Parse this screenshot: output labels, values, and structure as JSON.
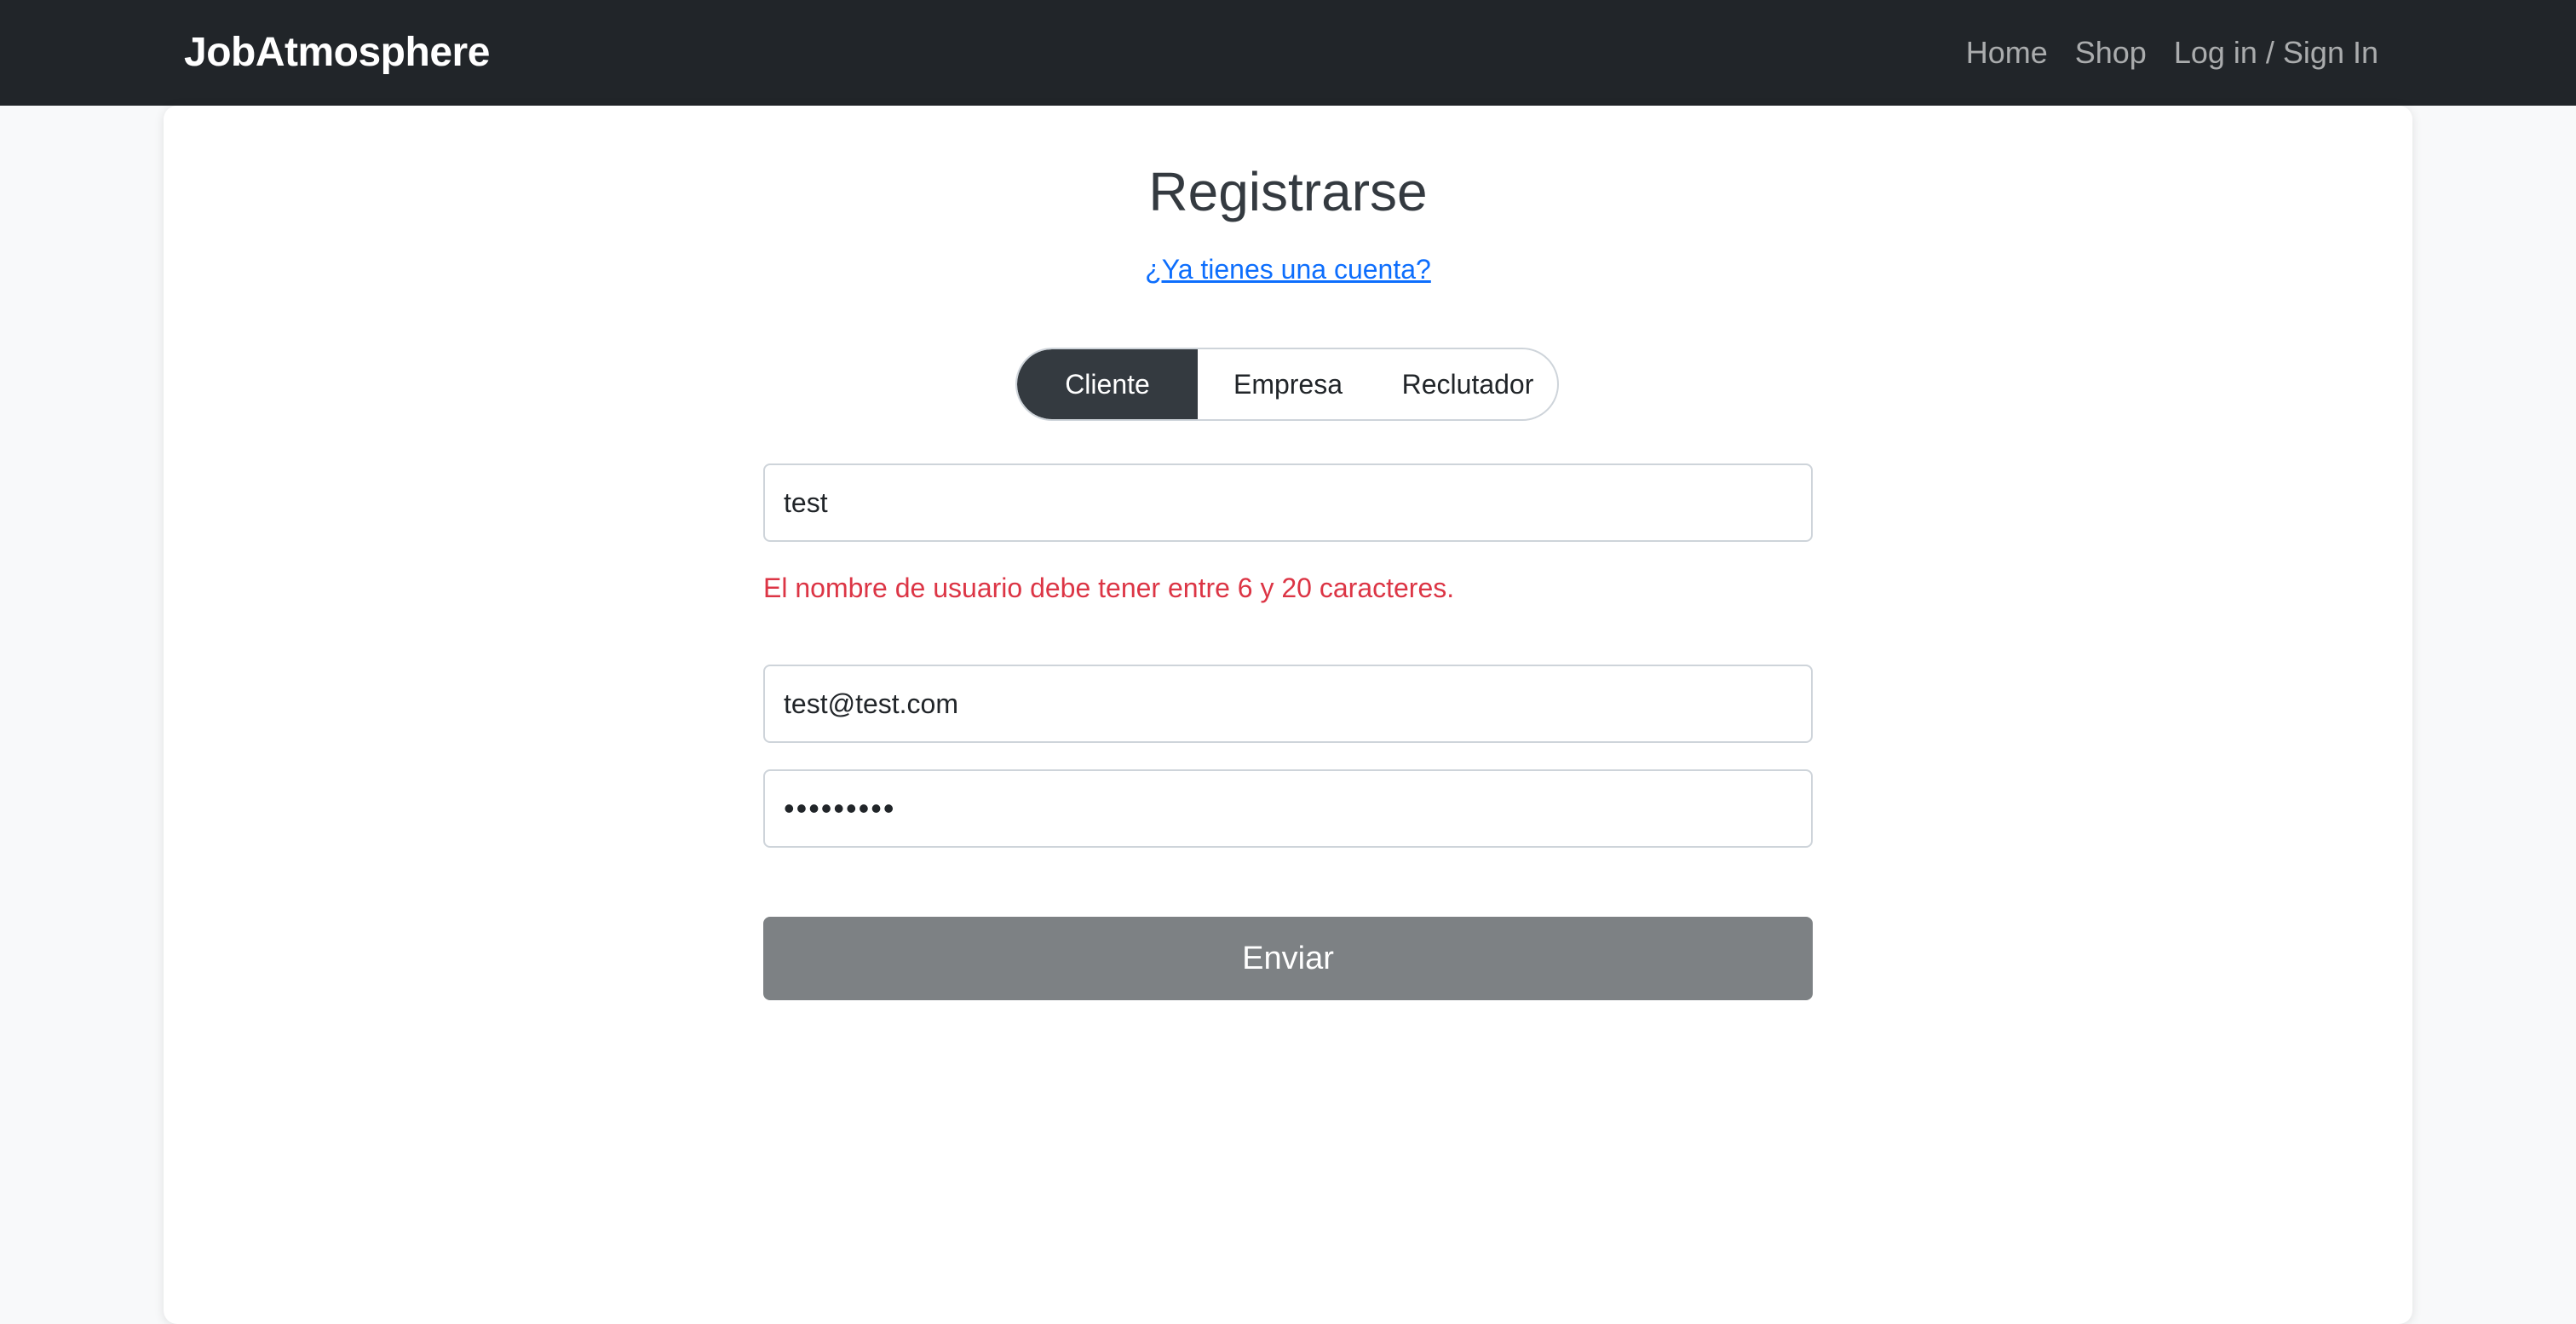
{
  "navbar": {
    "brand": "JobAtmosphere",
    "links": [
      {
        "label": "Home"
      },
      {
        "label": "Shop"
      },
      {
        "label": "Log in / Sign In"
      }
    ]
  },
  "form": {
    "title": "Registrarse",
    "login_link": "¿Ya tienes una cuenta?",
    "account_types": [
      {
        "label": "Cliente",
        "selected": true
      },
      {
        "label": "Empresa",
        "selected": false
      },
      {
        "label": "Reclutador",
        "selected": false
      }
    ],
    "username_value": "test",
    "username_error": "El nombre de usuario debe tener entre 6 y 20 caracteres.",
    "email_value": "test@test.com",
    "password_value": "•••••••••",
    "submit_label": "Enviar"
  },
  "colors": {
    "navbar_bg": "#212529",
    "active_toggle": "#343a40",
    "error": "#dc3545",
    "link": "#0d6efd",
    "submit_disabled": "#7d8184"
  }
}
